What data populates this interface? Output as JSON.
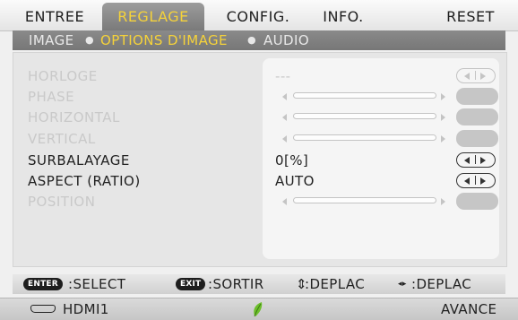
{
  "tabs": [
    {
      "label": "ENTREE",
      "active": false
    },
    {
      "label": "REGLAGE",
      "active": true
    },
    {
      "label": "CONFIG.",
      "active": false
    },
    {
      "label": "INFO.",
      "active": false
    },
    {
      "label": "RESET",
      "active": false
    }
  ],
  "subtabs": [
    {
      "label": "IMAGE",
      "active": false
    },
    {
      "label": "OPTIONS D'IMAGE",
      "active": true
    },
    {
      "label": "AUDIO",
      "active": false
    }
  ],
  "subtab_separator": "●",
  "rows": [
    {
      "label": "HORLOGE",
      "value": "---",
      "control": "arrows",
      "enabled": false
    },
    {
      "label": "PHASE",
      "value": "",
      "control": "slider",
      "enabled": false
    },
    {
      "label": "HORIZONTAL",
      "value": "",
      "control": "slider",
      "enabled": false
    },
    {
      "label": "VERTICAL",
      "value": "",
      "control": "slider",
      "enabled": false
    },
    {
      "label": "SURBALAYAGE",
      "value": "0[%]",
      "control": "arrows",
      "enabled": true
    },
    {
      "label": "ASPECT (RATIO)",
      "value": "AUTO",
      "control": "arrows",
      "enabled": true
    },
    {
      "label": "POSITION",
      "value": "",
      "control": "slider",
      "enabled": false
    }
  ],
  "help": {
    "enter_key": "ENTER",
    "enter_action": ":SELECT",
    "exit_key": "EXIT",
    "exit_action": ":SORTIR",
    "updown_glyph": "⇕",
    "updown_action": ":DEPLAC",
    "leftright_glyph": "◂▸",
    "leftright_action": ":DEPLAC"
  },
  "status": {
    "source": "HDMI1",
    "mode": "AVANCE",
    "eco_icon": "leaf-icon",
    "source_icon": "hdmi-icon"
  },
  "colors": {
    "active_tab_text": "#f5d23a",
    "disabled_text": "#c9c9c9",
    "eco_leaf": "#6cbf2a"
  }
}
